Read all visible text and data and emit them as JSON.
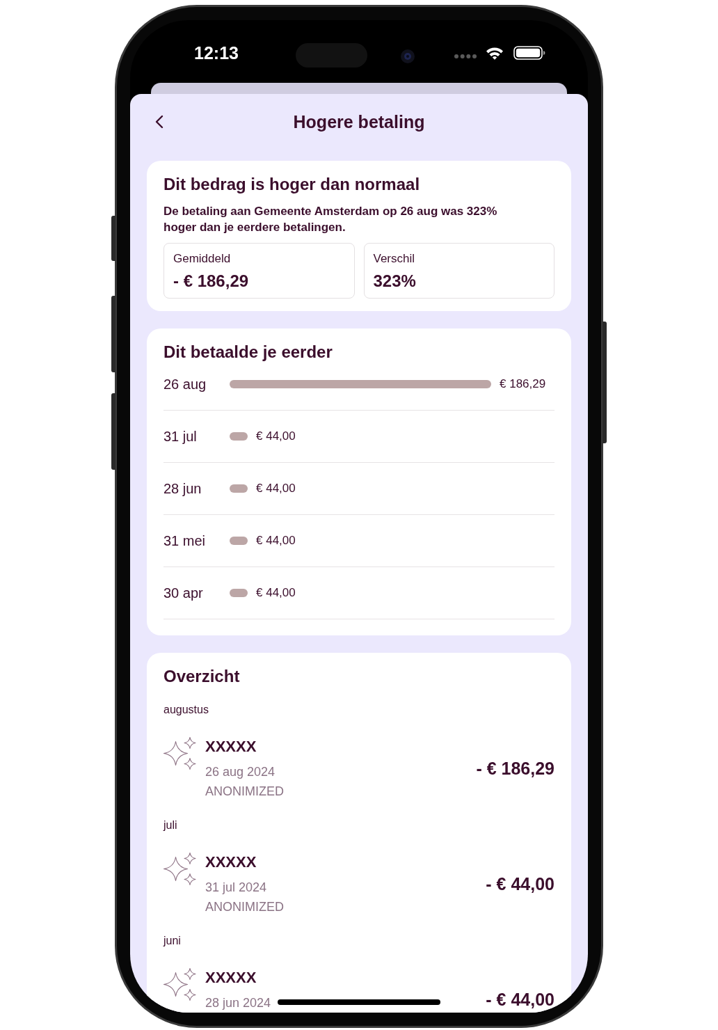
{
  "status_bar": {
    "time": "12:13"
  },
  "header": {
    "title": "Hogere betaling"
  },
  "alert_card": {
    "title": "Dit bedrag is hoger dan normaal",
    "message": "De betaling aan Gemeente Amsterdam op 26 aug was 323% hoger dan je eerdere betalingen.",
    "stats": [
      {
        "label": "Gemiddeld",
        "value": "- € 186,29"
      },
      {
        "label": "Verschil",
        "value": "323%"
      }
    ]
  },
  "history_card": {
    "title": "Dit betaalde je eerder",
    "chart_data": {
      "type": "bar",
      "orientation": "horizontal",
      "categories": [
        "26 aug",
        "31 jul",
        "28 jun",
        "31 mei",
        "30 apr"
      ],
      "values": [
        186.29,
        44,
        44,
        44,
        44
      ],
      "xlim": [
        33.4,
        186.29
      ],
      "value_labels": [
        "€ 186,29",
        "€ 44,00",
        "€ 44,00",
        "€ 44,00",
        "€ 44,00"
      ]
    }
  },
  "overview_card": {
    "title": "Overzicht",
    "groups": [
      {
        "month": "augustus",
        "transactions": [
          {
            "name": "XXXXX",
            "date": "26 aug 2024",
            "note": "ANONIMIZED",
            "amount": "- € 186,29"
          }
        ]
      },
      {
        "month": "juli",
        "transactions": [
          {
            "name": "XXXXX",
            "date": "31 jul 2024",
            "note": "ANONIMIZED",
            "amount": "- € 44,00"
          }
        ]
      },
      {
        "month": "juni",
        "transactions": [
          {
            "name": "XXXXX",
            "date": "28 jun 2024",
            "amount": "- € 44,00"
          }
        ]
      }
    ]
  }
}
